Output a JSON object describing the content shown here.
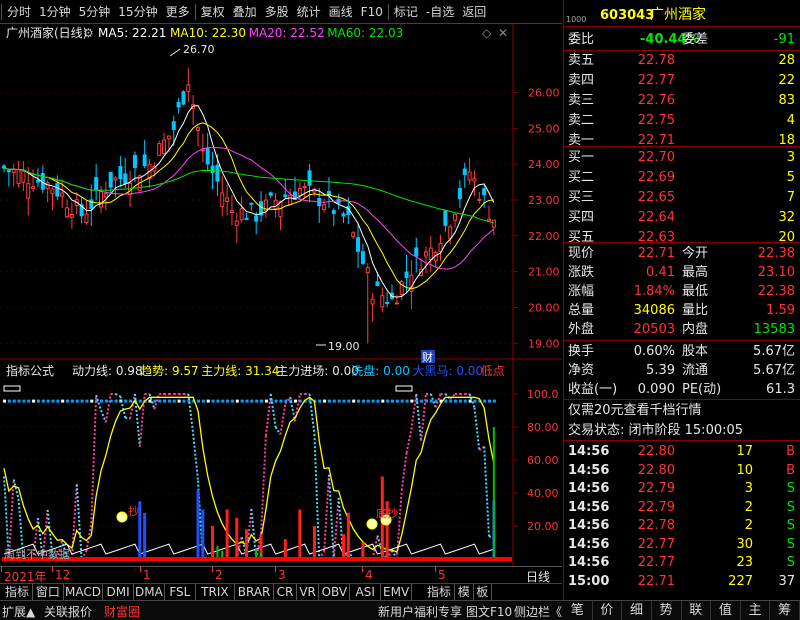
{
  "toolbar": {
    "items": [
      "分时",
      "1分钟",
      "5分钟",
      "15分钟",
      "更多",
      "复权",
      "叠加",
      "多股",
      "统计",
      "画线",
      "F10",
      "标记",
      "-自选",
      "返回"
    ]
  },
  "chart": {
    "stock_label": "广州酒家(日线)",
    "ma": [
      {
        "label": "MA5: 22.21",
        "color": "#ffffff"
      },
      {
        "label": "MA10: 22.30",
        "color": "#ffff00"
      },
      {
        "label": "MA20: 22.52",
        "color": "#ff40ff"
      },
      {
        "label": "MA60: 22.03",
        "color": "#00e600"
      }
    ],
    "high_marker": "26.70",
    "low_marker": "19.00",
    "cai_label": "财",
    "yticks": [
      "26.00",
      "25.00",
      "24.00",
      "23.00",
      "22.00",
      "21.00",
      "20.00",
      "19.00"
    ],
    "indicator_title": "指标公式",
    "ind": [
      {
        "label": "动力线: 0.98",
        "color": "#e6e6e6"
      },
      {
        "label": "趋势: 9.57",
        "color": "#ffff00"
      },
      {
        "label": "主力线: 31.34",
        "color": "#ffff00"
      },
      {
        "label": "主力进场: 0.00",
        "color": "#e6e6e6"
      },
      {
        "label": "洗盘: 0.00",
        "color": "#00c8ff"
      },
      {
        "label": "大黑马: 0.00",
        "color": "#2050ff"
      },
      {
        "label": "低点",
        "color": "#ff3232"
      }
    ],
    "ind_yticks": [
      "100.0",
      "80.00",
      "60.00",
      "40.00",
      "20.00"
    ],
    "annot_left": "抄",
    "annot_right": "底抄",
    "watermark": "周到不中数据",
    "date_labels": [
      "2021年",
      "12",
      "1",
      "2",
      "3",
      "4",
      "5"
    ],
    "period": "日线"
  },
  "chart_data": {
    "type": "candlestick",
    "ylim": [
      18.7,
      27.3
    ],
    "yticks": [
      26,
      25,
      24,
      23,
      22,
      21,
      20,
      19
    ],
    "high": 26.7,
    "low": 19.0,
    "indicator_ylim": [
      0,
      100
    ]
  },
  "tabs_row": [
    "指标A",
    "窗口",
    "MACD",
    "DMI",
    "DMA",
    "FSL",
    "TRIX",
    "BRAR",
    "CR",
    "VR",
    "OBV",
    "ASI",
    "EMV",
    "指标B",
    "模",
    "板"
  ],
  "bottom_bar": {
    "left": [
      "扩展▲",
      "关联报价",
      "财富圈"
    ],
    "right": [
      "新用户福利专享",
      "图文F10",
      "侧边栏《"
    ]
  },
  "quote": {
    "code": "603043",
    "name": "广州酒家",
    "wb_label": "委比",
    "wb": "-40.44%",
    "wc_label": "委差",
    "wc": "-91",
    "asks": [
      {
        "l": "卖五",
        "p": "22.78",
        "v": "28"
      },
      {
        "l": "卖四",
        "p": "22.77",
        "v": "22"
      },
      {
        "l": "卖三",
        "p": "22.76",
        "v": "83"
      },
      {
        "l": "卖二",
        "p": "22.75",
        "v": "4"
      },
      {
        "l": "卖一",
        "p": "22.71",
        "v": "18"
      }
    ],
    "bids": [
      {
        "l": "买一",
        "p": "22.70",
        "v": "3"
      },
      {
        "l": "买二",
        "p": "22.69",
        "v": "5"
      },
      {
        "l": "买三",
        "p": "22.65",
        "v": "7"
      },
      {
        "l": "买四",
        "p": "22.64",
        "v": "32"
      },
      {
        "l": "买五",
        "p": "22.63",
        "v": "20"
      }
    ],
    "stats": [
      {
        "l1": "现价",
        "v1": "22.71",
        "c1": "red",
        "l2": "今开",
        "v2": "22.38",
        "c2": "red"
      },
      {
        "l1": "涨跌",
        "v1": "0.41",
        "c1": "red",
        "l2": "最高",
        "v2": "23.10",
        "c2": "red"
      },
      {
        "l1": "涨幅",
        "v1": "1.84%",
        "c1": "red",
        "l2": "最低",
        "v2": "22.38",
        "c2": "red"
      },
      {
        "l1": "总量",
        "v1": "34086",
        "c1": "yel",
        "l2": "量比",
        "v2": "1.59",
        "c2": "red"
      },
      {
        "l1": "外盘",
        "v1": "20503",
        "c1": "red",
        "l2": "内盘",
        "v2": "13583",
        "c2": "grn"
      }
    ],
    "stats2": [
      {
        "l1": "换手",
        "v1": "0.60%",
        "l2": "股本",
        "v2": "5.67亿"
      },
      {
        "l1": "净资",
        "v1": "5.39",
        "l2": "流通",
        "v2": "5.67亿"
      },
      {
        "l1": "收益(一)",
        "v1": "0.090",
        "l2": "PE(动)",
        "v2": "61.3"
      }
    ],
    "promo": "仅需20元查看千档行情",
    "status": "交易状态: 闭市阶段 15:00:05",
    "ticks": [
      {
        "t": "14:56",
        "p": "22.80",
        "v": "17",
        "d": "B"
      },
      {
        "t": "14:56",
        "p": "22.80",
        "v": "10",
        "d": "B"
      },
      {
        "t": "14:56",
        "p": "22.79",
        "v": "3",
        "d": "S"
      },
      {
        "t": "14:56",
        "p": "22.79",
        "v": "2",
        "d": "S"
      },
      {
        "t": "14:56",
        "p": "22.78",
        "v": "2",
        "d": "S"
      },
      {
        "t": "14:56",
        "p": "22.77",
        "v": "30",
        "d": "S"
      },
      {
        "t": "14:56",
        "p": "22.77",
        "v": "23",
        "d": "S"
      },
      {
        "t": "15:00",
        "p": "22.71",
        "v": "227",
        "d": "37"
      }
    ],
    "bottom_tabs": [
      "笔",
      "价",
      "细",
      "势",
      "联",
      "值",
      "主",
      "筹"
    ]
  }
}
